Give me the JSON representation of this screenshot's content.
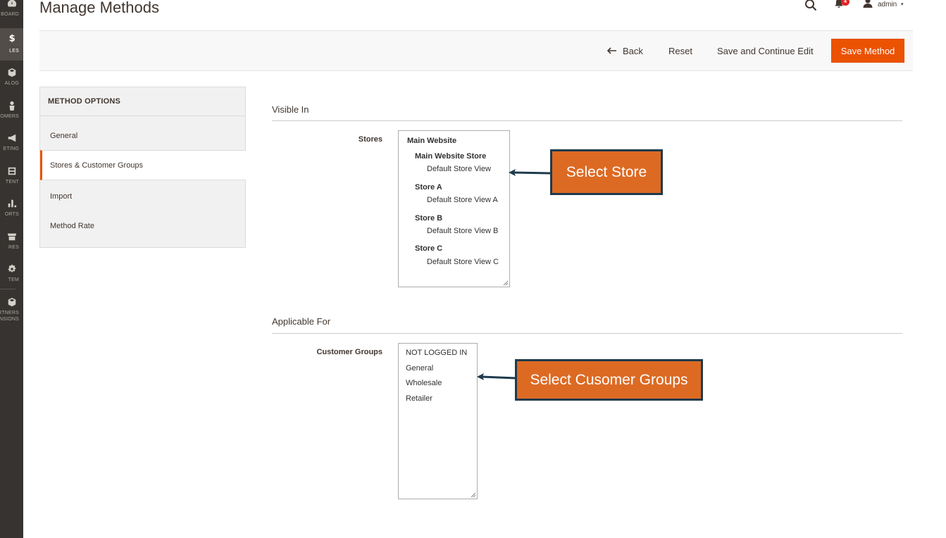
{
  "nav": {
    "items": [
      {
        "key": "dashboard",
        "label": "BOARD",
        "icon": "dashboard-icon",
        "active": false
      },
      {
        "key": "sales",
        "label": "LES",
        "icon": "dollar-icon",
        "active": true
      },
      {
        "key": "catalog",
        "label": "ALOG",
        "icon": "cube-icon",
        "active": false
      },
      {
        "key": "customers",
        "label": "OMERS",
        "icon": "person-icon",
        "active": false
      },
      {
        "key": "marketing",
        "label": "ETING",
        "icon": "megaphone-icon",
        "active": false
      },
      {
        "key": "content",
        "label": "TENT",
        "icon": "layout-icon",
        "active": false
      },
      {
        "key": "reports",
        "label": "ORTS",
        "icon": "bar-chart-icon",
        "active": false
      },
      {
        "key": "stores",
        "label": "RES",
        "icon": "storefront-icon",
        "active": false
      },
      {
        "key": "system",
        "label": "TEM",
        "icon": "gear-icon",
        "active": false
      },
      {
        "key": "partners",
        "label": "RTNERS\nNSIONS",
        "icon": "box-icon",
        "active": false
      }
    ]
  },
  "header": {
    "title": "Manage Methods",
    "notifications": "4",
    "user": "admin",
    "caret": "▾"
  },
  "toolbar": {
    "back_label": "Back",
    "reset_label": "Reset",
    "save_continue_label": "Save and Continue Edit",
    "save_label": "Save Method"
  },
  "sidebar": {
    "title": "METHOD OPTIONS",
    "tabs": [
      {
        "label": "General",
        "active": false
      },
      {
        "label": "Stores & Customer Groups",
        "active": true
      },
      {
        "label": "Import",
        "active": false
      },
      {
        "label": "Method Rate",
        "active": false
      }
    ]
  },
  "visible_in": {
    "title": "Visible In",
    "stores_label": "Stores",
    "options": [
      {
        "text": "Main Website",
        "level": 0,
        "bold": true
      },
      {
        "text": "Main Website Store",
        "level": 1,
        "bold": true
      },
      {
        "text": "Default Store View",
        "level": 2,
        "bold": false
      },
      {
        "text": "Store A",
        "level": 1,
        "bold": true
      },
      {
        "text": "Default Store View A",
        "level": 2,
        "bold": false
      },
      {
        "text": "Store B",
        "level": 1,
        "bold": true
      },
      {
        "text": "Default Store View B",
        "level": 2,
        "bold": false
      },
      {
        "text": "Store C",
        "level": 1,
        "bold": true
      },
      {
        "text": "Default Store View C",
        "level": 2,
        "bold": false
      }
    ]
  },
  "applicable_for": {
    "title": "Applicable For",
    "groups_label": "Customer Groups",
    "options": [
      "NOT LOGGED IN",
      "General",
      "Wholesale",
      "Retailer"
    ]
  },
  "callouts": {
    "store": "Select Store",
    "groups": "Select Cusomer Groups"
  },
  "colors": {
    "accent": "#eb5202",
    "callout_fill": "#dd6a23",
    "callout_border": "#1f3b4d",
    "nav_bg": "#373330"
  }
}
